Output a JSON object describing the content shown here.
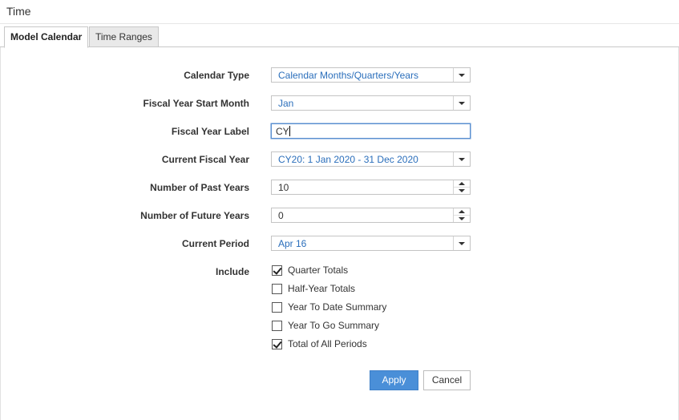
{
  "window": {
    "title": "Time"
  },
  "tabs": [
    {
      "label": "Model Calendar",
      "active": true
    },
    {
      "label": "Time Ranges",
      "active": false
    }
  ],
  "form": {
    "calendar_type": {
      "label": "Calendar Type",
      "value": "Calendar Months/Quarters/Years"
    },
    "fiscal_year_start_month": {
      "label": "Fiscal Year Start Month",
      "value": "Jan"
    },
    "fiscal_year_label": {
      "label": "Fiscal Year Label",
      "value": "CY"
    },
    "current_fiscal_year": {
      "label": "Current Fiscal Year",
      "value": "CY20: 1 Jan 2020 - 31 Dec 2020"
    },
    "number_of_past_years": {
      "label": "Number of Past Years",
      "value": "10"
    },
    "number_of_future_years": {
      "label": "Number of Future Years",
      "value": "0"
    },
    "current_period": {
      "label": "Current Period",
      "value": "Apr 16"
    },
    "include": {
      "label": "Include",
      "options": [
        {
          "label": "Quarter Totals",
          "checked": true
        },
        {
          "label": "Half-Year Totals",
          "checked": false
        },
        {
          "label": "Year To Date Summary",
          "checked": false
        },
        {
          "label": "Year To Go Summary",
          "checked": false
        },
        {
          "label": "Total of All Periods",
          "checked": true
        }
      ]
    }
  },
  "actions": {
    "apply": "Apply",
    "cancel": "Cancel"
  },
  "colors": {
    "accent": "#4a8fd8",
    "value_text": "#2a6ebb"
  }
}
